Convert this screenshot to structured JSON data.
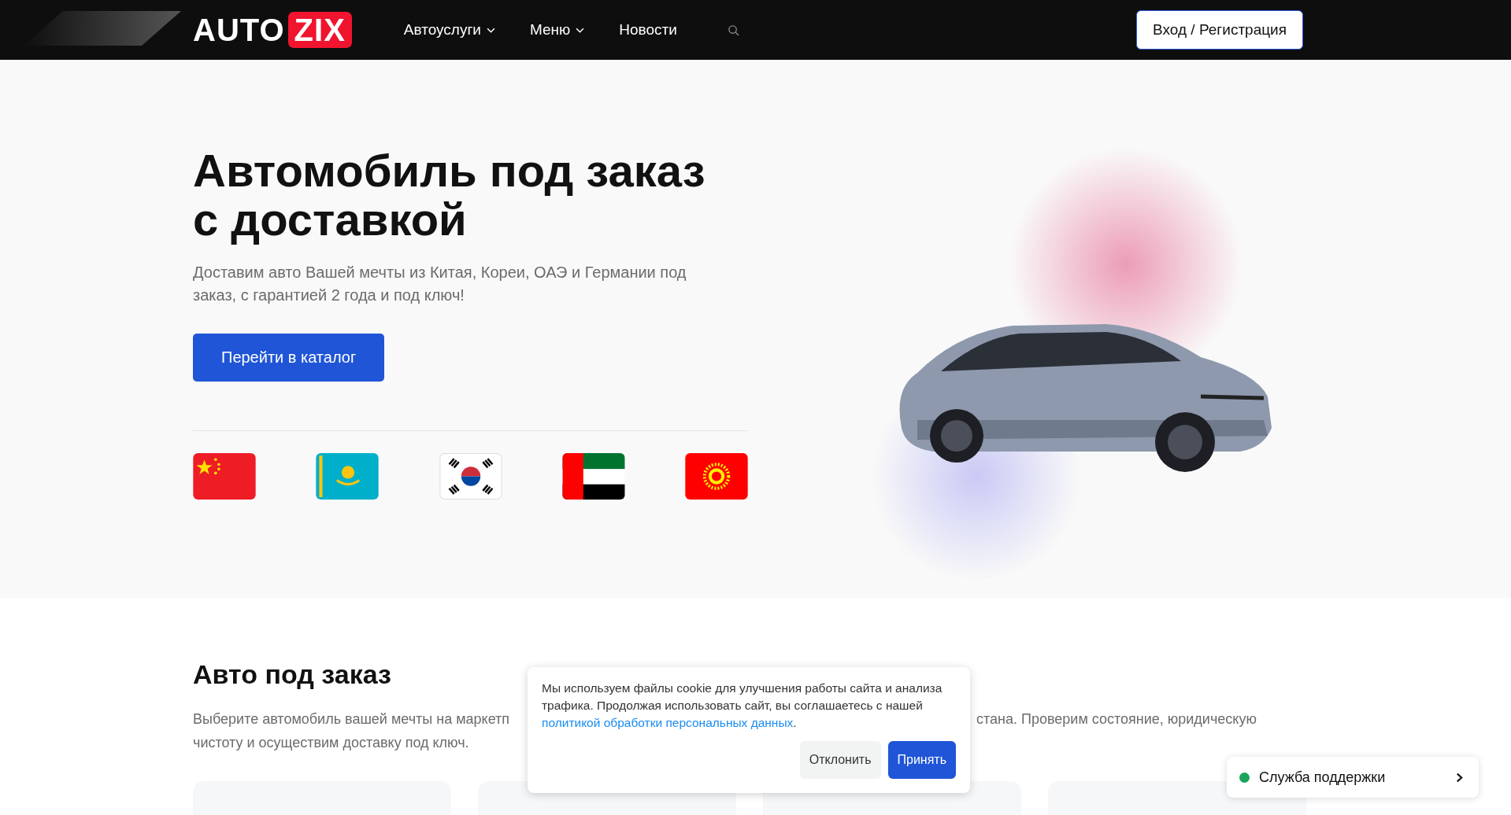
{
  "header": {
    "logo": {
      "text": "AUTO",
      "badge": "ZIX"
    },
    "nav": [
      {
        "label": "Автоуслуги",
        "has_menu": true
      },
      {
        "label": "Меню",
        "has_menu": true
      },
      {
        "label": "Новости",
        "has_menu": false
      }
    ],
    "login_button": "Вход / Регистрация"
  },
  "hero": {
    "title": "Автомобиль под заказ с доставкой",
    "subtitle": "Доставим авто Вашей мечты из Китая, Кореи, ОАЭ и Германии под заказ, с гарантией 2 года и под ключ!",
    "button": "Перейти в каталог",
    "flags": [
      {
        "kind": "china"
      },
      {
        "kind": "kazakhstan"
      },
      {
        "kind": "korea"
      },
      {
        "kind": "uae"
      },
      {
        "kind": "kyrgyzstan"
      }
    ]
  },
  "section": {
    "title": "Авто под заказ",
    "line_1_start": "Выберите автомобиль вашей мечты на маркетп",
    "line_1_end": "стана. Проверим состояние, юридическую",
    "line_2": "чистоту и осуществим доставку под ключ."
  },
  "cookie": {
    "text_before": "Мы используем файлы cookie для улучшения работы сайта и анализа трафика. Продолжая использовать сайт, вы соглашаетесь с нашей ",
    "link": "политикой обработки персональных данных",
    "text_after": ".",
    "decline": "Отклонить",
    "accept": "Принять"
  },
  "support": {
    "label": "Служба поддержки",
    "online": true
  }
}
